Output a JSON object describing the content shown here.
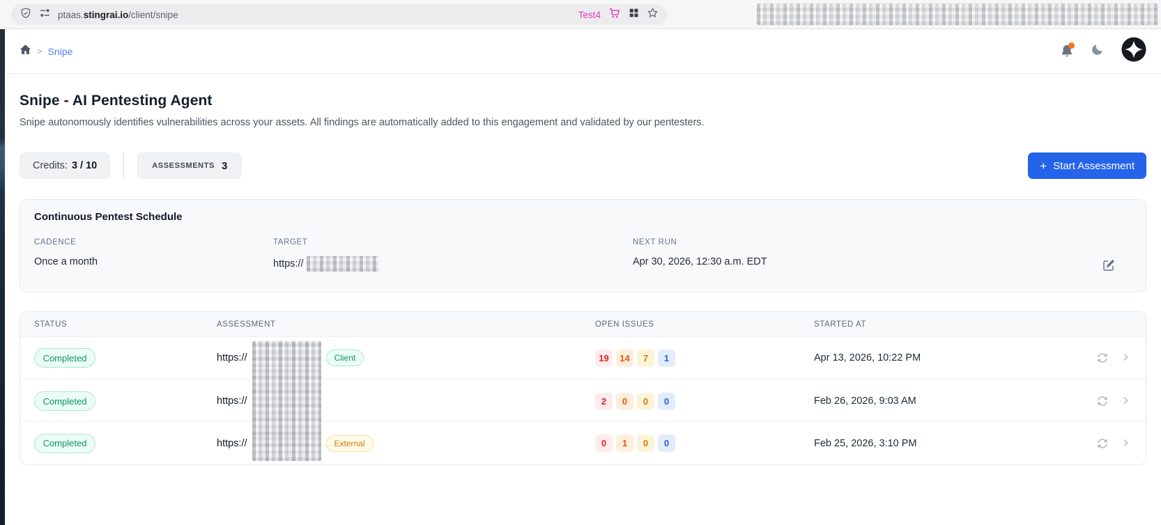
{
  "browser": {
    "url": {
      "prefix": "ptaas.",
      "domain": "stingrai.io",
      "path": "/client/snipe"
    },
    "profile_label": "Test4",
    "icons": {
      "site_security": "shield-icon",
      "permissions": "toggle-icon",
      "cart": "cart-icon",
      "extensions": "grid-icon",
      "bookmark": "star-icon"
    }
  },
  "header": {
    "breadcrumb_separator": ">",
    "breadcrumb_current": "Snipe",
    "icons": {
      "home": "home-icon",
      "notifications": "bell-icon",
      "theme": "moon-icon",
      "logo": "logo-mark"
    }
  },
  "page": {
    "title": "Snipe - AI Pentesting Agent",
    "subtitle": "Snipe autonomously identifies vulnerabilities across your assets. All findings are automatically added to this engagement and validated by our pentesters."
  },
  "toolbar": {
    "credits_label": "Credits:",
    "credits_value": "3 / 10",
    "assessments_label": "ASSESSMENTS",
    "assessments_count": "3",
    "plus": "+",
    "start_assessment_label": "Start Assessment"
  },
  "schedule": {
    "card_title": "Continuous Pentest Schedule",
    "cadence_label": "CADENCE",
    "target_label": "TARGET",
    "next_run_label": "NEXT RUN",
    "cadence_value": "Once a month",
    "target_prefix": "https://",
    "next_run_value": "Apr 30, 2026, 12:30 a.m. EDT"
  },
  "table": {
    "status_label": "STATUS",
    "assessment_label": "ASSESSMENT",
    "open_issues_label": "OPEN ISSUES",
    "started_at_label": "STARTED AT",
    "rows": [
      {
        "status": "Completed",
        "url_prefix": "https://",
        "tag": "Client",
        "issues": [
          "19",
          "14",
          "7",
          "1"
        ],
        "started_at": "Apr 13, 2026, 10:22 PM"
      },
      {
        "status": "Completed",
        "url_prefix": "https://",
        "tag": "",
        "issues": [
          "2",
          "0",
          "0",
          "0"
        ],
        "started_at": "Feb 26, 2026, 9:03 AM"
      },
      {
        "status": "Completed",
        "url_prefix": "https://",
        "tag": "External",
        "issues": [
          "0",
          "1",
          "0",
          "0"
        ],
        "started_at": "Feb 25, 2026, 3:10 PM"
      }
    ]
  },
  "colors": {
    "accent_blue": "#2563eb",
    "link_blue": "#4f83f1",
    "profile_pink": "#e23bb4",
    "status_green": "#0a9467",
    "sev_critical": "#dc2626",
    "sev_high": "#ea580c",
    "sev_medium": "#d97706",
    "sev_low": "#2563eb",
    "notification_orange": "#f97316"
  }
}
